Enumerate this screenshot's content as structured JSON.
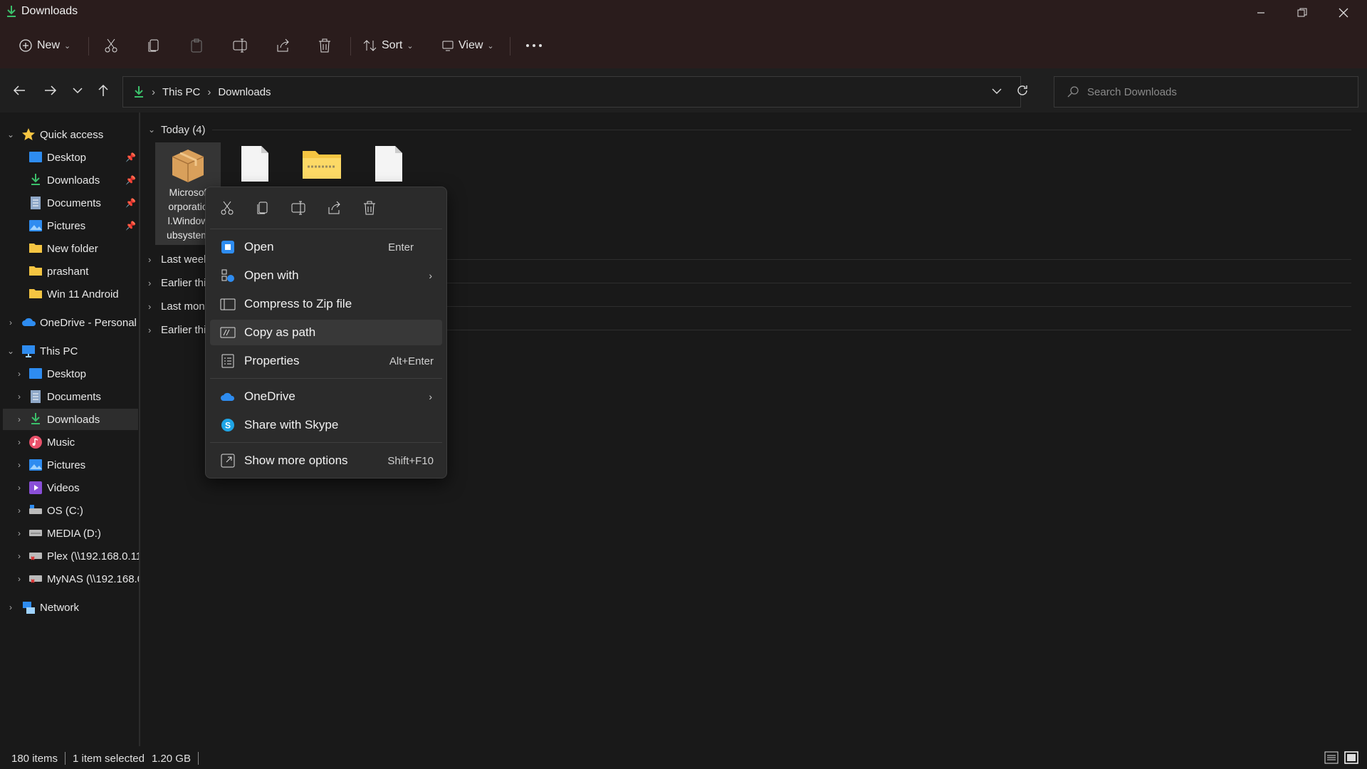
{
  "window": {
    "title": "Downloads"
  },
  "toolbar": {
    "new_label": "New",
    "sort_label": "Sort",
    "view_label": "View"
  },
  "address": {
    "crumbs": [
      "This PC",
      "Downloads"
    ]
  },
  "search": {
    "placeholder": "Search Downloads"
  },
  "sidebar": {
    "quick_access": "Quick access",
    "quick_items": [
      "Desktop",
      "Downloads",
      "Documents",
      "Pictures",
      "New folder",
      "prashant",
      "Win 11 Android"
    ],
    "onedrive": "OneDrive - Personal",
    "this_pc": "This PC",
    "pc_items": [
      "Desktop",
      "Documents",
      "Downloads",
      "Music",
      "Pictures",
      "Videos",
      "OS (C:)",
      "MEDIA (D:)",
      "Plex (\\\\192.168.0.11",
      "MyNAS (\\\\192.168.0"
    ],
    "network": "Network"
  },
  "content": {
    "groups": [
      "Today (4)",
      "Last week",
      "Earlier thi",
      "Last mont",
      "Earlier thi"
    ],
    "selected_file_lines": [
      "Microsof",
      "orporatio",
      "l.Window",
      "ubsystem"
    ]
  },
  "context_menu": {
    "items": [
      {
        "label": "Open",
        "shortcut": "Enter",
        "icon": "app-open-icon"
      },
      {
        "label": "Open with",
        "shortcut": "",
        "icon": "open-with-icon"
      },
      {
        "label": "Compress to Zip file",
        "shortcut": "",
        "icon": "zip-icon"
      },
      {
        "label": "Copy as path",
        "shortcut": "",
        "icon": "copy-path-icon"
      },
      {
        "label": "Properties",
        "shortcut": "Alt+Enter",
        "icon": "properties-icon"
      },
      {
        "label": "OneDrive",
        "shortcut": "",
        "icon": "onedrive-icon"
      },
      {
        "label": "Share with Skype",
        "shortcut": "",
        "icon": "skype-icon"
      },
      {
        "label": "Show more options",
        "shortcut": "Shift+F10",
        "icon": "more-options-icon"
      }
    ]
  },
  "status": {
    "items": "180 items",
    "selected": "1 item selected",
    "size": "1.20 GB"
  },
  "colors": {
    "accent": "#2e8cf0",
    "folder": "#f5c542",
    "download_green": "#3bbf6a",
    "titlebar": "#2a1c1c"
  }
}
